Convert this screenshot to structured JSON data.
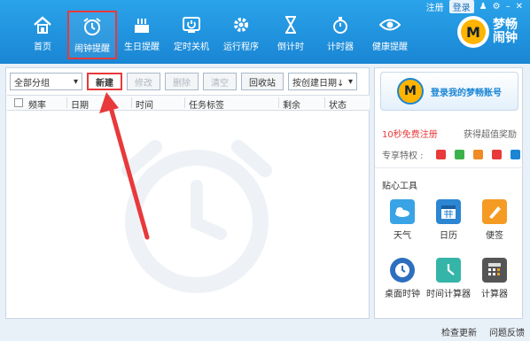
{
  "top_links": {
    "register": "注册",
    "login": "登录"
  },
  "nav": [
    {
      "label": "首页",
      "icon": "home-icon"
    },
    {
      "label": "闹钟提醒",
      "icon": "alarm-clock-icon"
    },
    {
      "label": "生日提醒",
      "icon": "cake-icon"
    },
    {
      "label": "定时关机",
      "icon": "power-icon"
    },
    {
      "label": "运行程序",
      "icon": "gear-icon"
    },
    {
      "label": "倒计时",
      "icon": "hourglass-icon"
    },
    {
      "label": "计时器",
      "icon": "stopwatch-icon"
    },
    {
      "label": "健康提醒",
      "icon": "eye-icon"
    }
  ],
  "logo": {
    "title": "梦畅闹钟",
    "letter": "M"
  },
  "toolbar": {
    "group_select": "全部分组",
    "new": "新建",
    "edit": "修改",
    "delete": "删除",
    "clear": "清空",
    "recycle": "回收站",
    "sort_select": "按创建日期↓"
  },
  "columns": [
    "频率",
    "日期",
    "时间",
    "任务标签",
    "剩余",
    "状态"
  ],
  "sidebar": {
    "login_text": "登录我的梦畅账号",
    "promo_left": "10秒免费注册",
    "promo_right": "获得超值奖励",
    "privilege_label": "专享特权 :",
    "tools_title": "贴心工具",
    "tools": [
      {
        "label": "天气",
        "icon": "weather-icon"
      },
      {
        "label": "日历",
        "icon": "calendar-icon"
      },
      {
        "label": "便签",
        "icon": "note-icon"
      },
      {
        "label": "桌面时钟",
        "icon": "desk-clock-icon"
      },
      {
        "label": "时间计算器",
        "icon": "time-calc-icon"
      },
      {
        "label": "计算器",
        "icon": "calculator-icon"
      }
    ]
  },
  "footer": {
    "check_update": "检查更新",
    "feedback": "问题反馈"
  },
  "colors": {
    "header": "#1a86d4",
    "highlight": "#e8393b",
    "accent": "#ffb400"
  }
}
